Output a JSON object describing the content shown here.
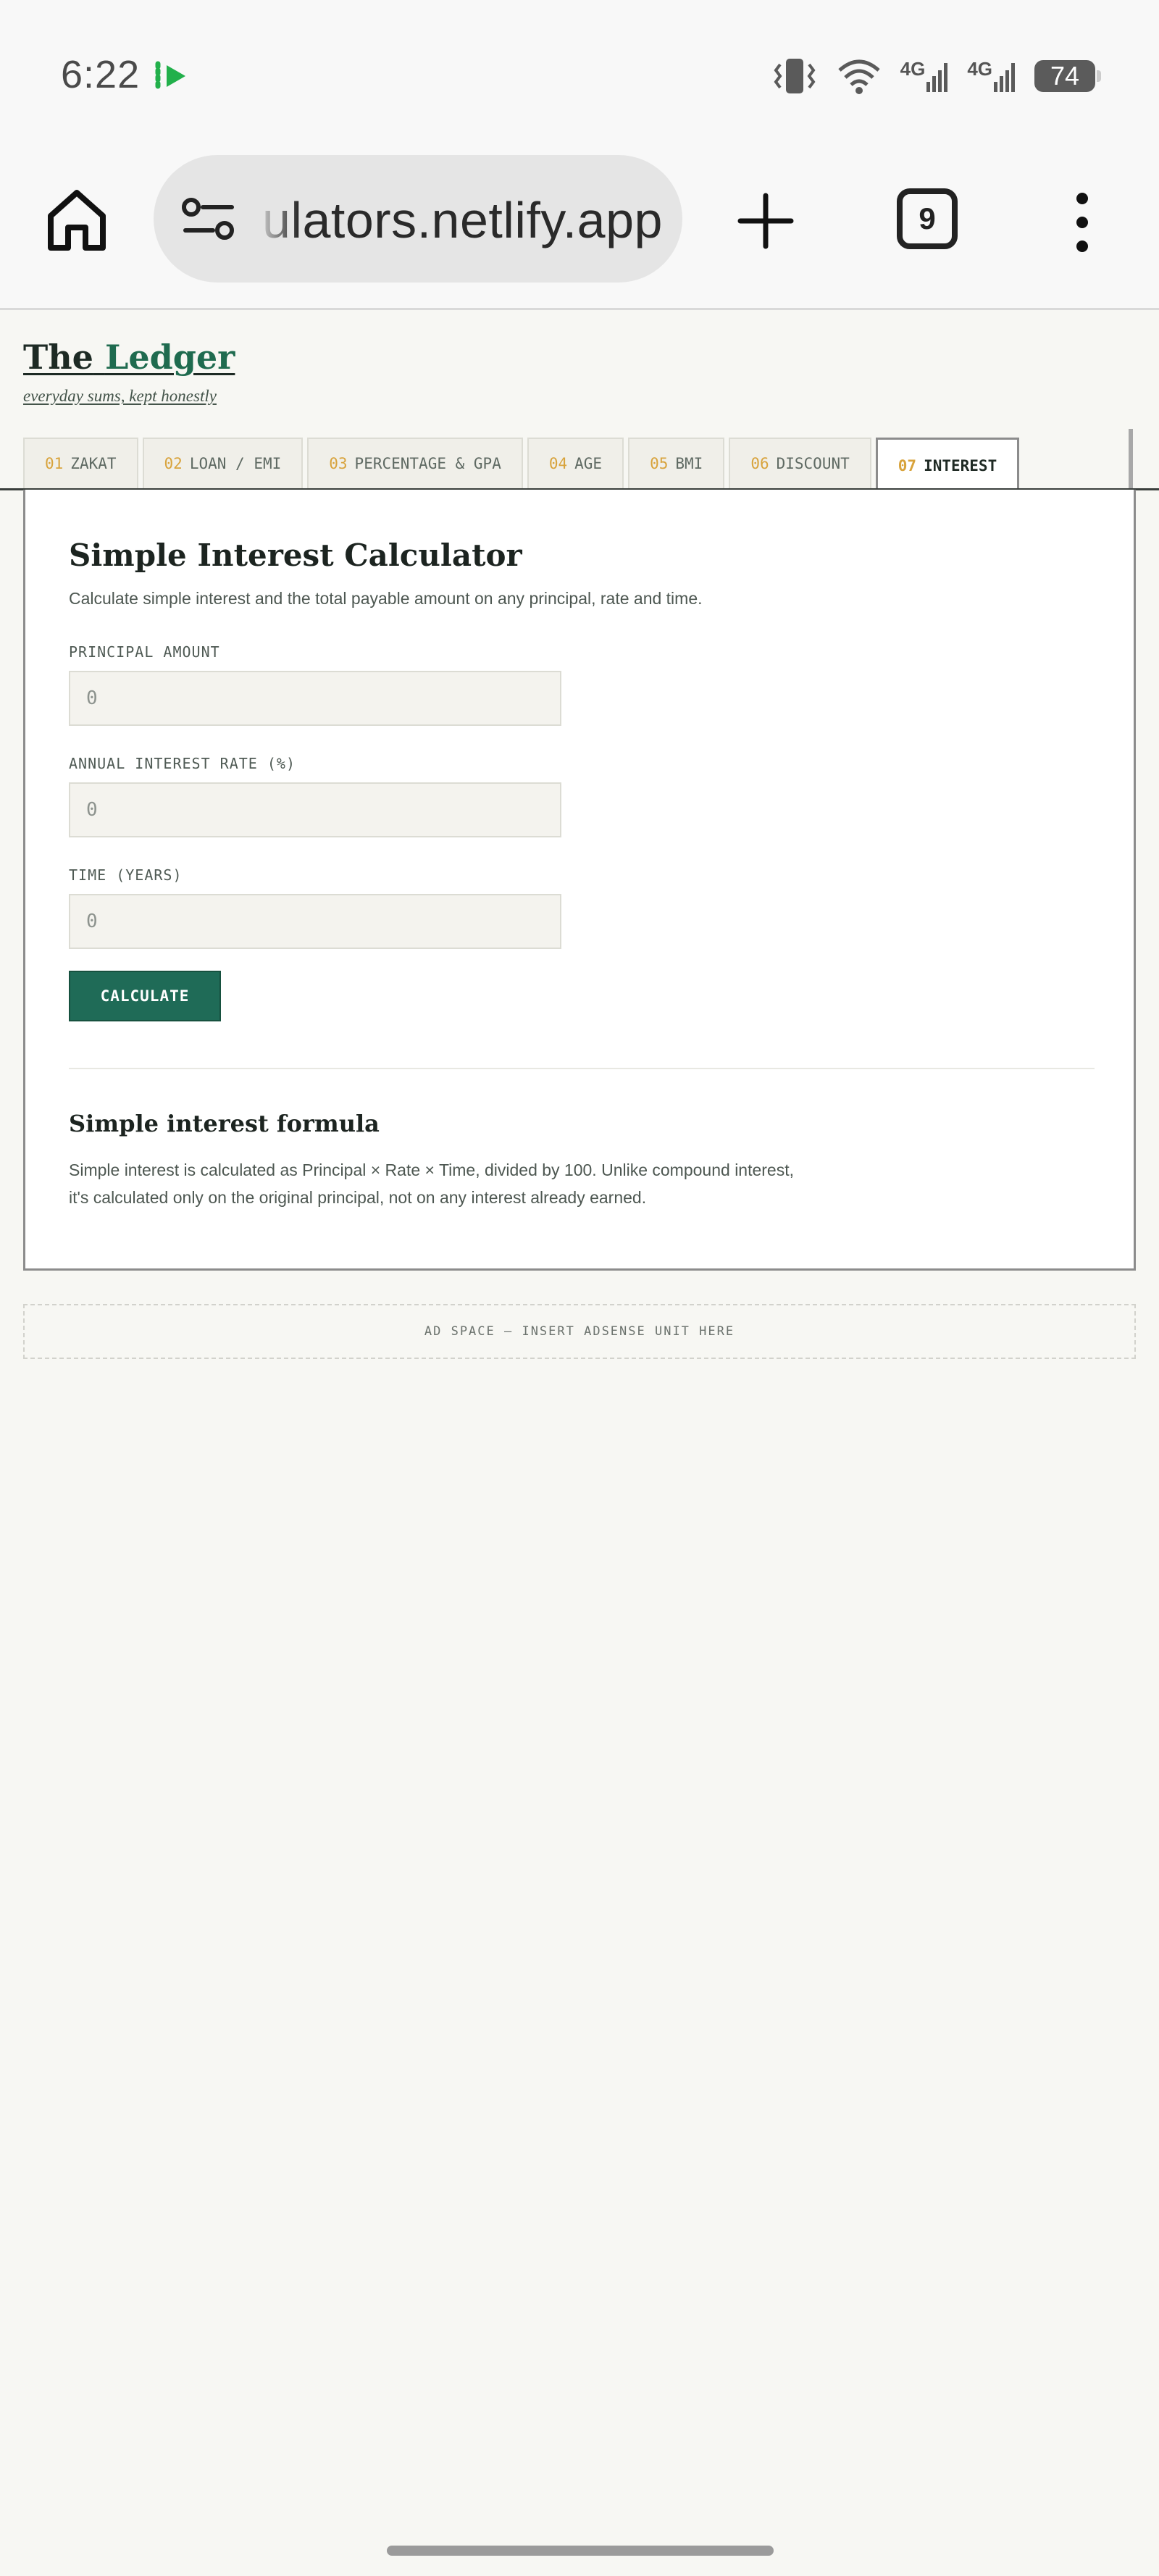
{
  "status_bar": {
    "time": "6:22",
    "network_1": "4G",
    "network_2": "4G",
    "battery": "74"
  },
  "browser": {
    "url": "ulators.netlify.app",
    "tab_count": "9"
  },
  "site": {
    "brand_the": "The",
    "brand_name": "Ledger",
    "tagline": "everyday sums, kept honestly"
  },
  "tabs": [
    {
      "num": "01",
      "label": "ZAKAT"
    },
    {
      "num": "02",
      "label": "LOAN / EMI"
    },
    {
      "num": "03",
      "label": "PERCENTAGE & GPA"
    },
    {
      "num": "04",
      "label": "AGE"
    },
    {
      "num": "05",
      "label": "BMI"
    },
    {
      "num": "06",
      "label": "DISCOUNT"
    },
    {
      "num": "07",
      "label": "INTEREST"
    }
  ],
  "calculator": {
    "title": "Simple Interest Calculator",
    "subtitle": "Calculate simple interest and the total payable amount on any principal, rate and time.",
    "fields": [
      {
        "label": "PRINCIPAL AMOUNT",
        "placeholder": "0"
      },
      {
        "label": "ANNUAL INTEREST RATE (%)",
        "placeholder": "0"
      },
      {
        "label": "TIME (YEARS)",
        "placeholder": "0"
      }
    ],
    "button_label": "CALCULATE",
    "formula_title": "Simple interest formula",
    "formula_text": "Simple interest is calculated as Principal × Rate × Time, divided by 100. Unlike compound interest, it's calculated only on the original principal, not on any interest already earned."
  },
  "ad_text": "AD SPACE — INSERT ADSENSE UNIT HERE",
  "colors": {
    "accent": "#1f6b57",
    "tab_number": "#d8a33c",
    "page_bg": "#f7f7f3"
  }
}
